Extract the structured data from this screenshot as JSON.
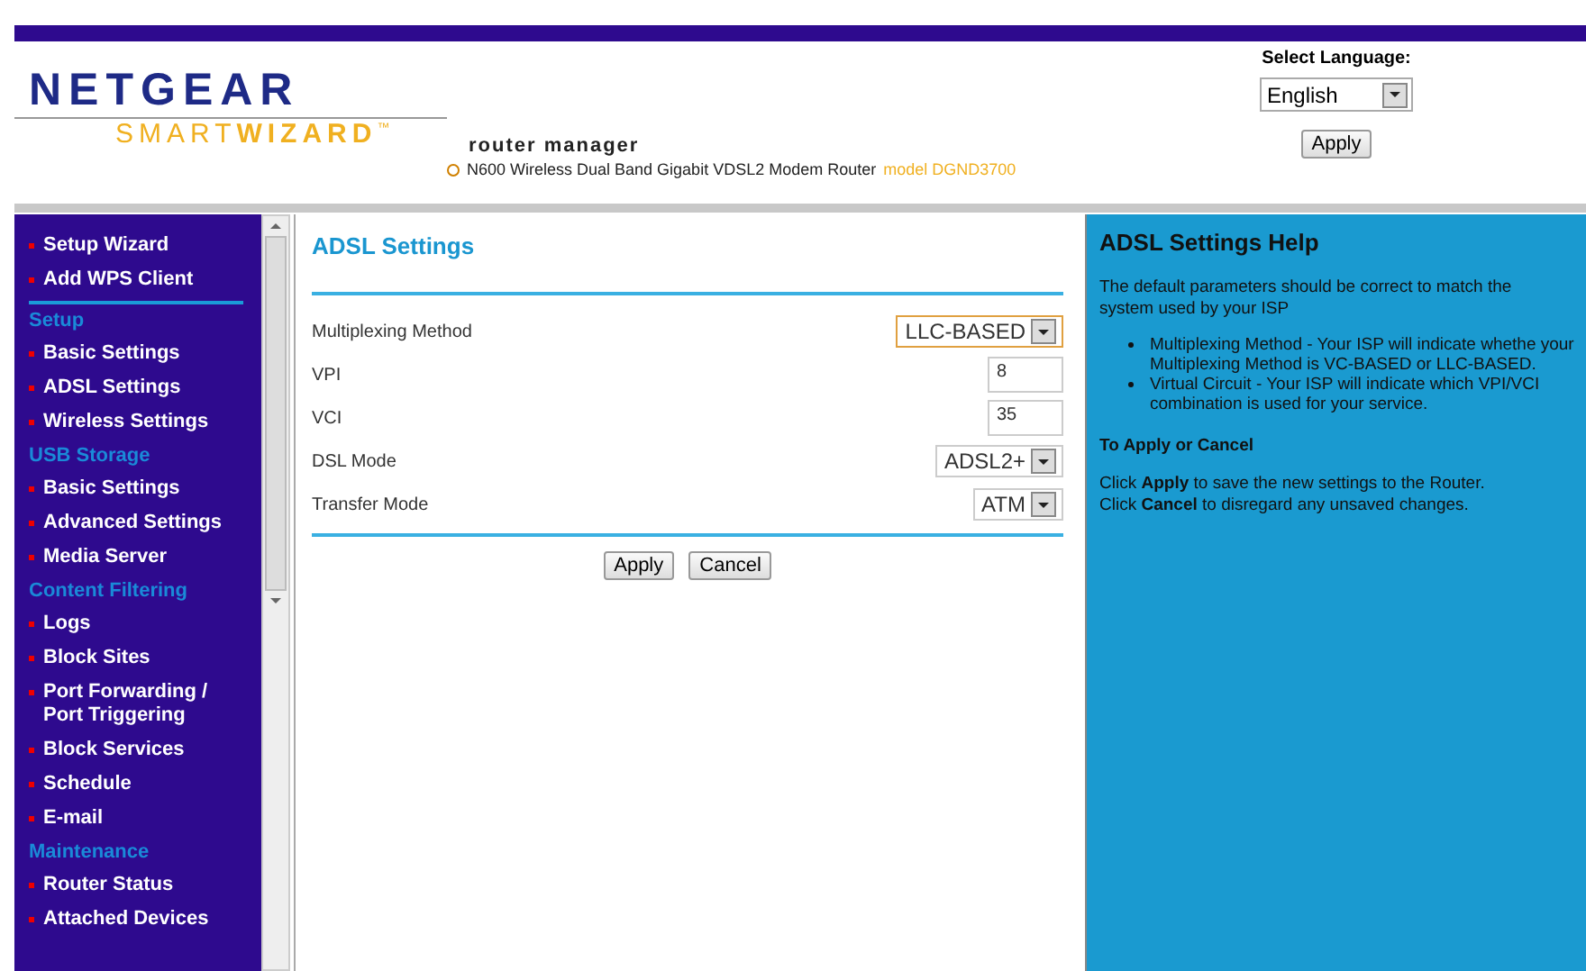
{
  "header": {
    "logo": {
      "brand": "NETGEAR",
      "smart": "SMART",
      "wizard": "WIZARD",
      "tm": "™"
    },
    "product": "router manager",
    "model_line": "N600 Wireless Dual Band Gigabit VDSL2 Modem Router",
    "model": "model DGND3700",
    "language_label": "Select Language:",
    "language": "English",
    "apply": "Apply"
  },
  "sidebar": {
    "items": [
      {
        "kind": "link",
        "label": "Setup Wizard"
      },
      {
        "kind": "link",
        "label": "Add WPS Client"
      },
      {
        "kind": "divider"
      },
      {
        "kind": "heading",
        "label": "Setup"
      },
      {
        "kind": "link",
        "label": "Basic Settings"
      },
      {
        "kind": "link",
        "label": "ADSL Settings"
      },
      {
        "kind": "link",
        "label": "Wireless Settings"
      },
      {
        "kind": "heading",
        "label": "USB Storage"
      },
      {
        "kind": "link",
        "label": "Basic Settings"
      },
      {
        "kind": "link",
        "label": "Advanced Settings"
      },
      {
        "kind": "link",
        "label": "Media Server"
      },
      {
        "kind": "heading",
        "label": "Content Filtering"
      },
      {
        "kind": "link",
        "label": "Logs"
      },
      {
        "kind": "link",
        "label": "Block Sites"
      },
      {
        "kind": "link",
        "label": "Port Forwarding / Port Triggering"
      },
      {
        "kind": "link",
        "label": "Block Services"
      },
      {
        "kind": "link",
        "label": "Schedule"
      },
      {
        "kind": "link",
        "label": "E-mail"
      },
      {
        "kind": "heading",
        "label": "Maintenance"
      },
      {
        "kind": "link",
        "label": "Router Status"
      },
      {
        "kind": "link",
        "label": "Attached Devices"
      }
    ]
  },
  "main": {
    "title": "ADSL Settings",
    "fields": [
      {
        "kind": "select",
        "label": "Multiplexing Method",
        "value": "LLC-BASED",
        "focused": true
      },
      {
        "kind": "text",
        "label": "VPI",
        "value": "8"
      },
      {
        "kind": "text",
        "label": "VCI",
        "value": "35"
      },
      {
        "kind": "select",
        "label": "DSL Mode",
        "value": "ADSL2+",
        "focused": false
      },
      {
        "kind": "select",
        "label": "Transfer Mode",
        "value": "ATM",
        "focused": false
      }
    ],
    "buttons": [
      "Apply",
      "Cancel"
    ]
  },
  "help": {
    "title": "ADSL Settings Help",
    "intro": "The default parameters should be correct to match the system used by your ISP",
    "bullets": [
      "Multiplexing Method - Your ISP will indicate whethe your Multiplexing Method is VC-BASED or LLC-BASED.",
      "Virtual Circuit - Your ISP will indicate which VPI/VCI combination is used for your service."
    ],
    "subtitle": "To Apply or Cancel",
    "lines": [
      "Click **Apply** to save the new settings to the Router.",
      "Click **Cancel** to disregard any unsaved changes."
    ]
  }
}
